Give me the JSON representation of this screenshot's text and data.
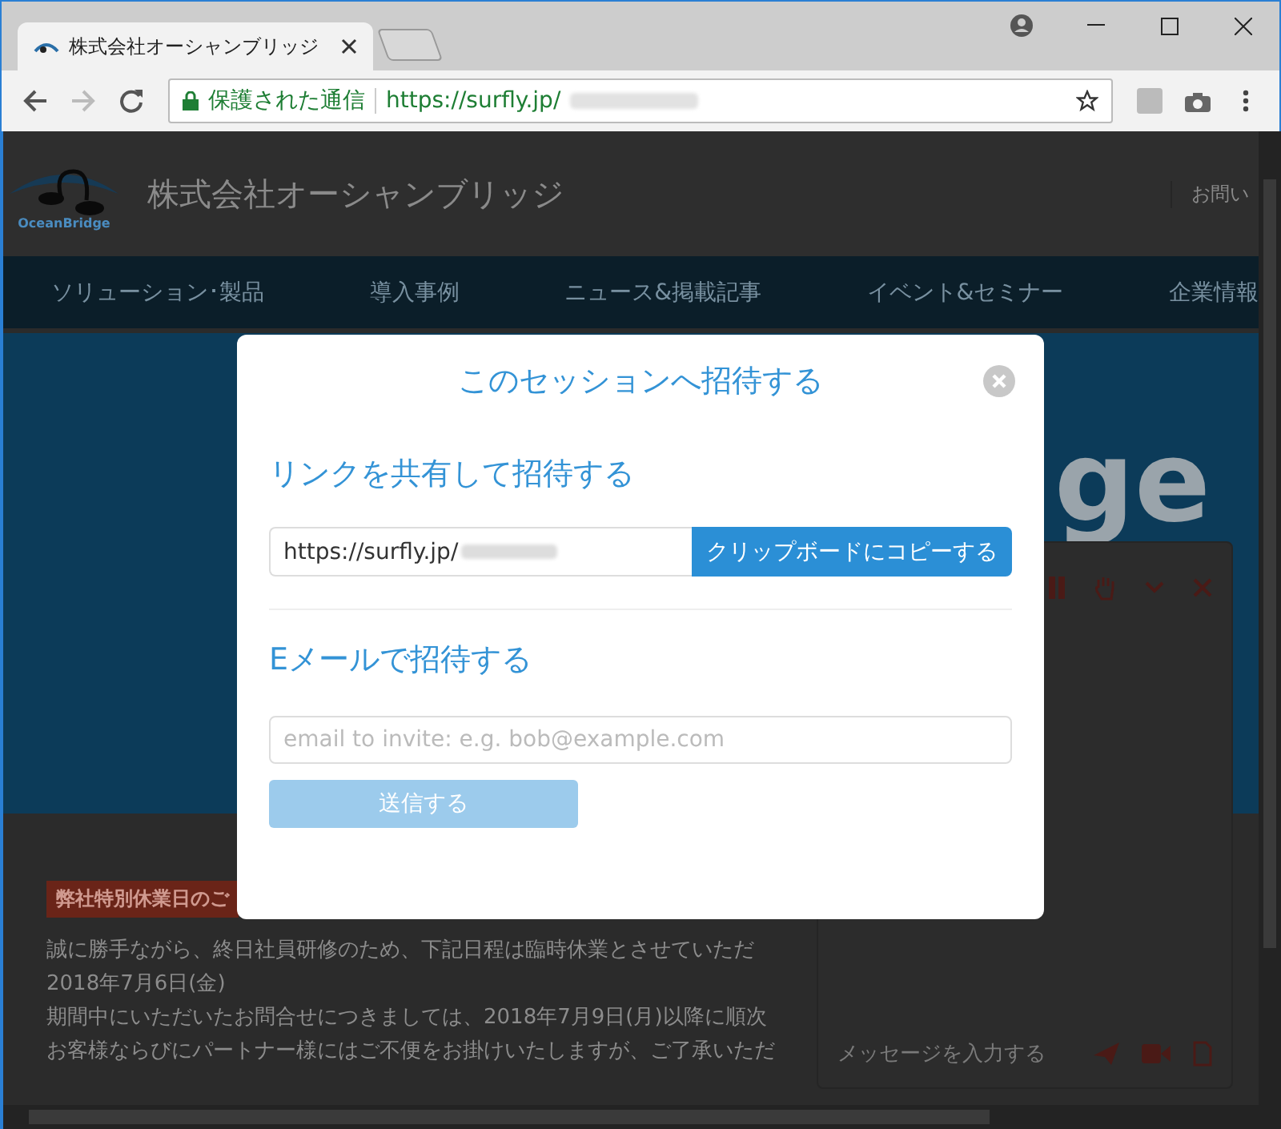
{
  "browser": {
    "tab_title": "株式会社オーシャンブリッジ",
    "address": {
      "security_label": "保護された通信",
      "url": "https://surfly.jp/"
    }
  },
  "page": {
    "logo_text": "OceanBridge",
    "company": "株式会社オーシャンブリッジ",
    "contact_link": "お問い",
    "nav": [
      "ソリューション･製品",
      "導入事例",
      "ニュース&掲載記事",
      "イベント&セミナー",
      "企業情報"
    ],
    "hero_text": "ge",
    "notice_tag": "弊社特別休業日のご",
    "paragraphs": [
      "誠に勝手ながら、終日社員研修のため、下記日程は臨時休業とさせていただ",
      "2018年7月6日(金)",
      "期間中にいただいたお問合せにつきましては、2018年7月9日(月)以降に順次",
      "お客様ならびにパートナー様にはご不便をお掛けいたしますが、ご了承いただ"
    ]
  },
  "chat": {
    "placeholder": "メッセージを入力する"
  },
  "dialog": {
    "title": "このセッションへ招待する",
    "link_heading": "リンクを共有して招待する",
    "link_value": "https://surfly.jp/",
    "copy_button": "クリップボードにコピーする",
    "email_heading": "Eメールで招待する",
    "email_placeholder": "email to invite: e.g. bob@example.com",
    "send_button": {
      "label": "送信する",
      "disabled": true
    }
  }
}
